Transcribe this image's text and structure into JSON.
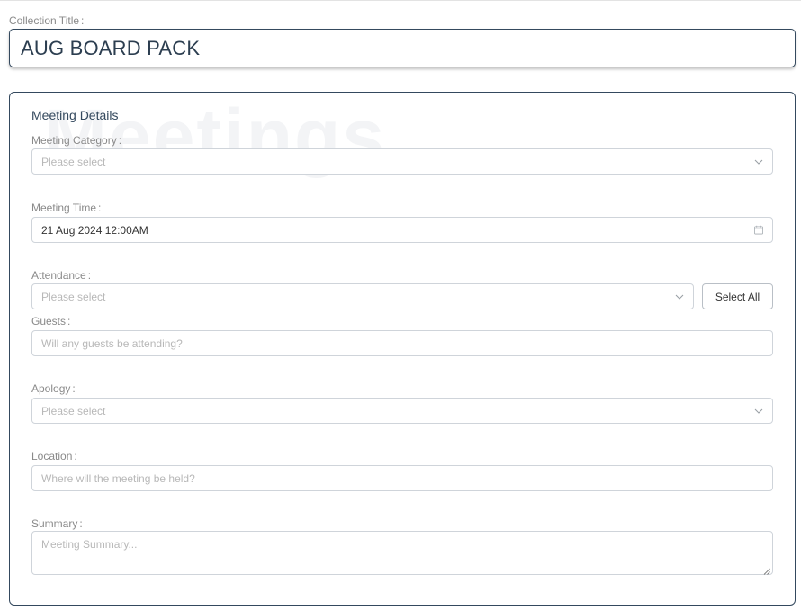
{
  "collection": {
    "label": "Collection Title",
    "value": "AUG BOARD PACK"
  },
  "panel": {
    "watermark": "Meetings",
    "section_title": "Meeting Details"
  },
  "fields": {
    "category": {
      "label": "Meeting Category",
      "placeholder": "Please select",
      "icon": "chevron-down-icon"
    },
    "time": {
      "label": "Meeting Time",
      "value": "21 Aug 2024 12:00AM",
      "icon": "calendar-icon"
    },
    "attendance": {
      "label": "Attendance",
      "placeholder": "Please select",
      "icon": "chevron-down-icon",
      "select_all_label": "Select All"
    },
    "guests": {
      "label": "Guests",
      "placeholder": "Will any guests be attending?"
    },
    "apology": {
      "label": "Apology",
      "placeholder": "Please select",
      "icon": "chevron-down-icon"
    },
    "location": {
      "label": "Location",
      "placeholder": "Where will the meeting be held?"
    },
    "summary": {
      "label": "Summary",
      "placeholder": "Meeting Summary..."
    }
  },
  "colors": {
    "border_accent": "#34495e",
    "field_border": "#cfd4da",
    "placeholder": "#b8b8b8",
    "label": "#8a8a8a"
  }
}
